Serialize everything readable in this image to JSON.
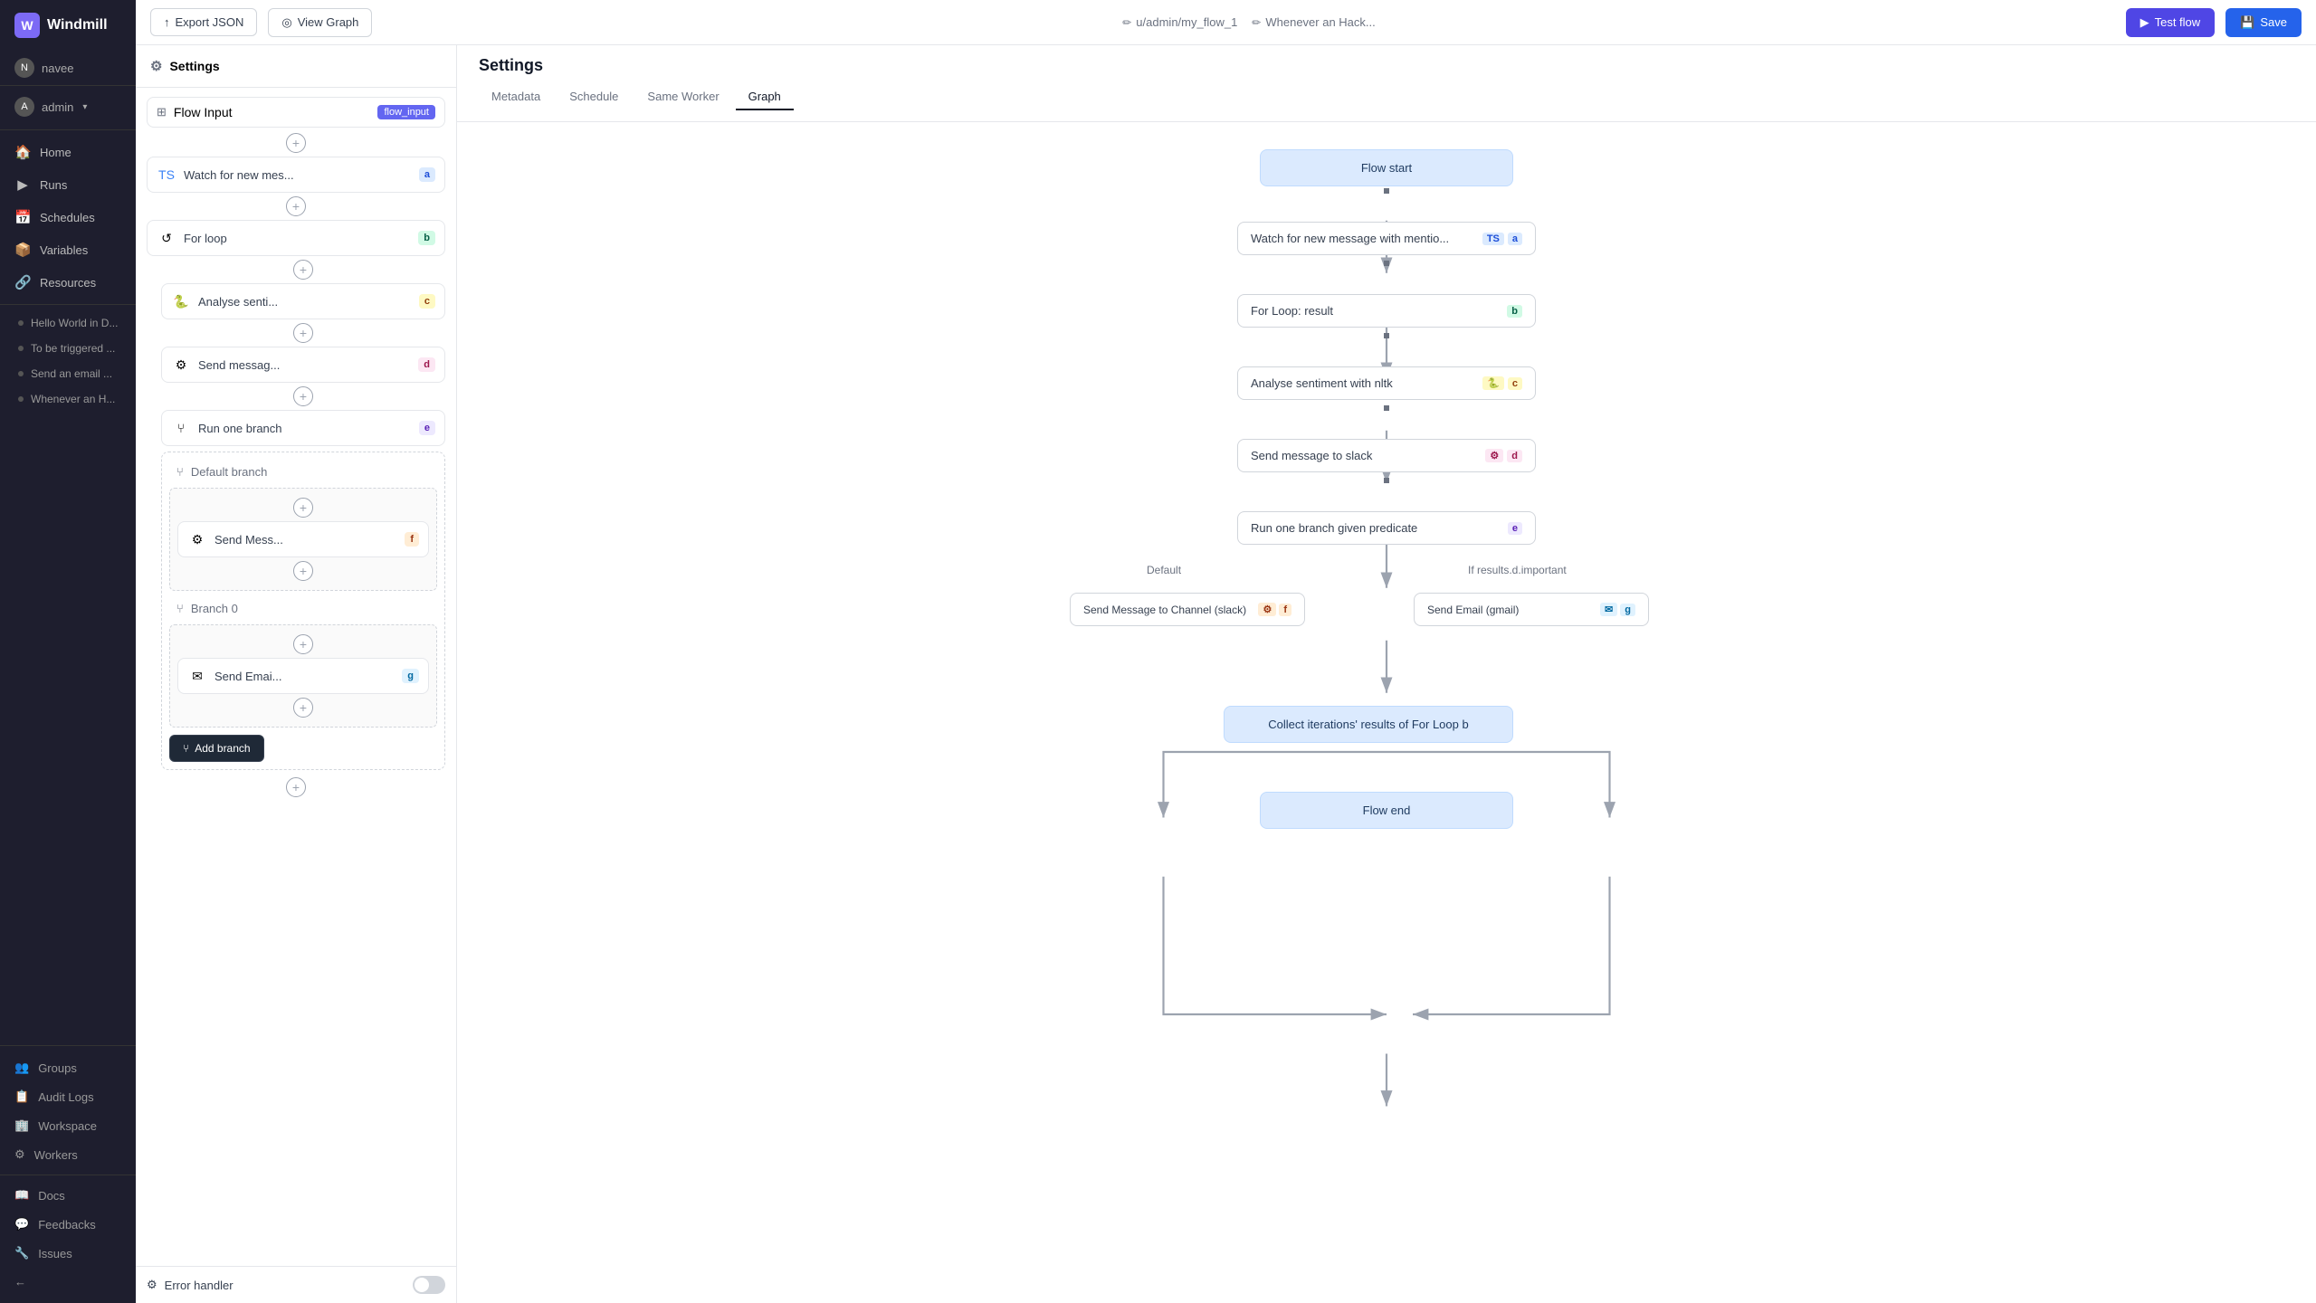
{
  "app": {
    "name": "Windmill"
  },
  "topbar": {
    "export_json": "Export JSON",
    "view_graph": "View Graph",
    "path": "u/admin/my_flow_1",
    "trigger": "Whenever an Hack...",
    "test_flow": "Test flow",
    "save": "Save"
  },
  "left_panel": {
    "settings_label": "Settings",
    "flow_input_label": "Flow Input",
    "flow_input_badge": "flow_input"
  },
  "steps": [
    {
      "id": "a",
      "label": "Watch for new mes...",
      "badge": "a",
      "badge_class": "badge-a",
      "icon": "⚙",
      "indent": 0
    },
    {
      "id": "b",
      "label": "For loop",
      "badge": "b",
      "badge_class": "badge-b",
      "icon": "↺",
      "indent": 0
    },
    {
      "id": "c",
      "label": "Analyse senti...",
      "badge": "c",
      "badge_class": "badge-c",
      "icon": "🐍",
      "indent": 1
    },
    {
      "id": "d",
      "label": "Send messag...",
      "badge": "d",
      "badge_class": "badge-d",
      "icon": "⚙",
      "indent": 1
    },
    {
      "id": "e",
      "label": "Run one branch",
      "badge": "e",
      "badge_class": "badge-e",
      "icon": "⑂",
      "indent": 1
    }
  ],
  "branch": {
    "default_label": "Default branch",
    "branch0_label": "Branch 0",
    "step_f": {
      "label": "Send Mess...",
      "badge": "f",
      "badge_class": "badge-f",
      "icon": "⚙"
    },
    "step_g": {
      "label": "Send Emai...",
      "badge": "g",
      "badge_class": "badge-g",
      "icon": "✉"
    },
    "add_branch_label": "Add branch"
  },
  "error_handler": {
    "label": "Error handler"
  },
  "tabs": [
    {
      "label": "Metadata",
      "active": false
    },
    {
      "label": "Schedule",
      "active": false
    },
    {
      "label": "Same Worker",
      "active": false
    },
    {
      "label": "Graph",
      "active": true
    }
  ],
  "settings_title": "Settings",
  "graph": {
    "nodes": {
      "flow_start": "Flow start",
      "watch": "Watch for new message with mentio...",
      "for_loop": "For Loop: result",
      "analyse": "Analyse sentiment with nltk",
      "send_slack": "Send message to slack",
      "run_branch": "Run one branch given predicate",
      "send_channel": "Send Message to Channel (slack)",
      "send_email": "Send Email (gmail)",
      "collect": "Collect iterations' results of For Loop b",
      "flow_end": "Flow end"
    },
    "labels": {
      "default": "Default",
      "if_results": "If results.d.important"
    }
  },
  "sidebar": {
    "logo": "Windmill",
    "user": "navee",
    "admin": "admin",
    "nav": [
      {
        "label": "Home",
        "icon": "🏠"
      },
      {
        "label": "Runs",
        "icon": "▶"
      },
      {
        "label": "Schedules",
        "icon": "📅"
      },
      {
        "label": "Variables",
        "icon": "📦"
      },
      {
        "label": "Resources",
        "icon": "🔗"
      }
    ],
    "flows": [
      {
        "label": "Hello World in D..."
      },
      {
        "label": "To be triggered ..."
      },
      {
        "label": "Send an email ..."
      },
      {
        "label": "Whenever an H..."
      }
    ],
    "bottom": [
      {
        "label": "Groups",
        "icon": "👥"
      },
      {
        "label": "Audit Logs",
        "icon": "📋"
      },
      {
        "label": "Workspace",
        "icon": "🏢"
      },
      {
        "label": "Workers",
        "icon": "⚙"
      }
    ],
    "docs": [
      {
        "label": "Docs",
        "icon": "📖"
      },
      {
        "label": "Feedbacks",
        "icon": "💬"
      },
      {
        "label": "Issues",
        "icon": "🔧"
      }
    ]
  }
}
